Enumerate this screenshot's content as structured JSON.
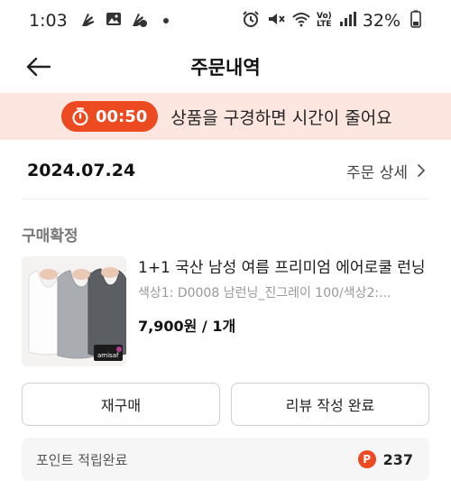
{
  "status_bar": {
    "time": "1:03",
    "network": "Vo)\nLTE",
    "battery": "32%"
  },
  "header": {
    "title": "주문내역"
  },
  "timer_banner": {
    "time": "00:50",
    "message": "상품을 구경하면 시간이 줄어요"
  },
  "order": {
    "date": "2024.07.24",
    "detail_link": "주문 상세",
    "status": "구매확정",
    "product": {
      "name": "1+1 국산 남성 여름 프리미엄 에어로쿨 런닝",
      "option": "색상1: D0008 남런닝_진그레이 100/색상2:...",
      "price": "7,900원 / 1개",
      "thumb_brand": "amisaf"
    },
    "buttons": {
      "rebuy": "재구매",
      "review": "리뷰 작성 완료"
    },
    "points": {
      "label": "포인트 적립완료",
      "badge": "P",
      "value": "237"
    }
  },
  "colors": {
    "accent": "#ee4a21",
    "banner_bg": "#fde6e0"
  }
}
